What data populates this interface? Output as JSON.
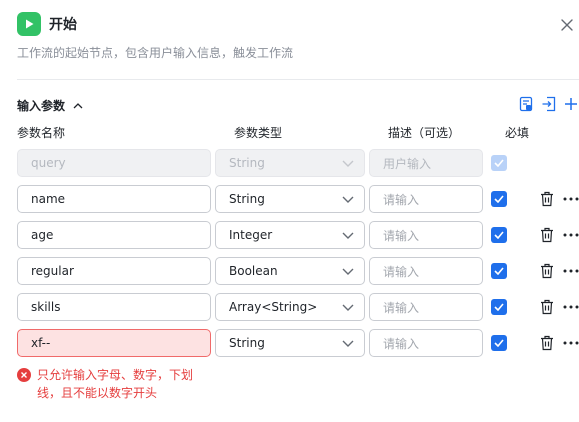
{
  "header": {
    "title": "开始",
    "description": "工作流的起始节点，包含用户输入信息，触发工作流"
  },
  "section": {
    "title": "输入参数"
  },
  "columns": {
    "name": "参数名称",
    "type": "参数类型",
    "desc": "描述（可选）",
    "required": "必填"
  },
  "rows": [
    {
      "name": "query",
      "type": "String",
      "desc": "用户输入",
      "required": true,
      "disabled": true
    },
    {
      "name": "name",
      "type": "String",
      "desc": "请输入",
      "required": true,
      "disabled": false
    },
    {
      "name": "age",
      "type": "Integer",
      "desc": "请输入",
      "required": true,
      "disabled": false
    },
    {
      "name": "regular",
      "type": "Boolean",
      "desc": "请输入",
      "required": true,
      "disabled": false
    },
    {
      "name": "skills",
      "type": "Array<String>",
      "desc": "请输入",
      "required": true,
      "disabled": false
    },
    {
      "name": "xf--",
      "type": "String",
      "desc": "请输入",
      "required": true,
      "disabled": false,
      "error": true
    }
  ],
  "error": {
    "line1": "只允许输入字母、数字，下划",
    "line2": "线，且不能以数字开头"
  },
  "colors": {
    "accent": "#1f6feb",
    "start_icon": "#32c266",
    "error": "#e53e3e"
  }
}
